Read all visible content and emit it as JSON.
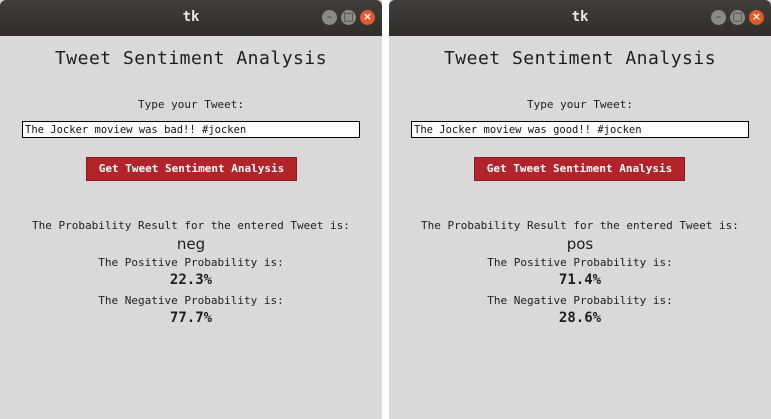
{
  "windows": [
    {
      "title": "tk",
      "heading": "Tweet Sentiment Analysis",
      "prompt_label": "Type your Tweet:",
      "tweet_value": "The Jocker moview was bad!! #jocken",
      "button_label": "Get Tweet Sentiment Analysis",
      "result_label": "The Probability Result for the entered Tweet is:",
      "sentiment": "neg",
      "positive_label": "The Positive Probability is:",
      "positive_value": "22.3%",
      "negative_label": "The Negative Probability is:",
      "negative_value": "77.7%"
    },
    {
      "title": "tk",
      "heading": "Tweet Sentiment Analysis",
      "prompt_label": "Type your Tweet:",
      "tweet_value": "The Jocker moview was good!! #jocken",
      "button_label": "Get Tweet Sentiment Analysis",
      "result_label": "The Probability Result for the entered Tweet is:",
      "sentiment": "pos",
      "positive_label": "The Positive Probability is:",
      "positive_value": "71.4%",
      "negative_label": "The Negative Probability is:",
      "negative_value": "28.6%"
    }
  ],
  "window_controls": {
    "minimize_icon": "minimize-icon",
    "maximize_icon": "maximize-icon",
    "close_icon": "close-icon"
  },
  "colors": {
    "titlebar": "#34332f",
    "window_bg": "#d9d9d9",
    "button_bg": "#b2242a",
    "close_button": "#e05a2c"
  }
}
